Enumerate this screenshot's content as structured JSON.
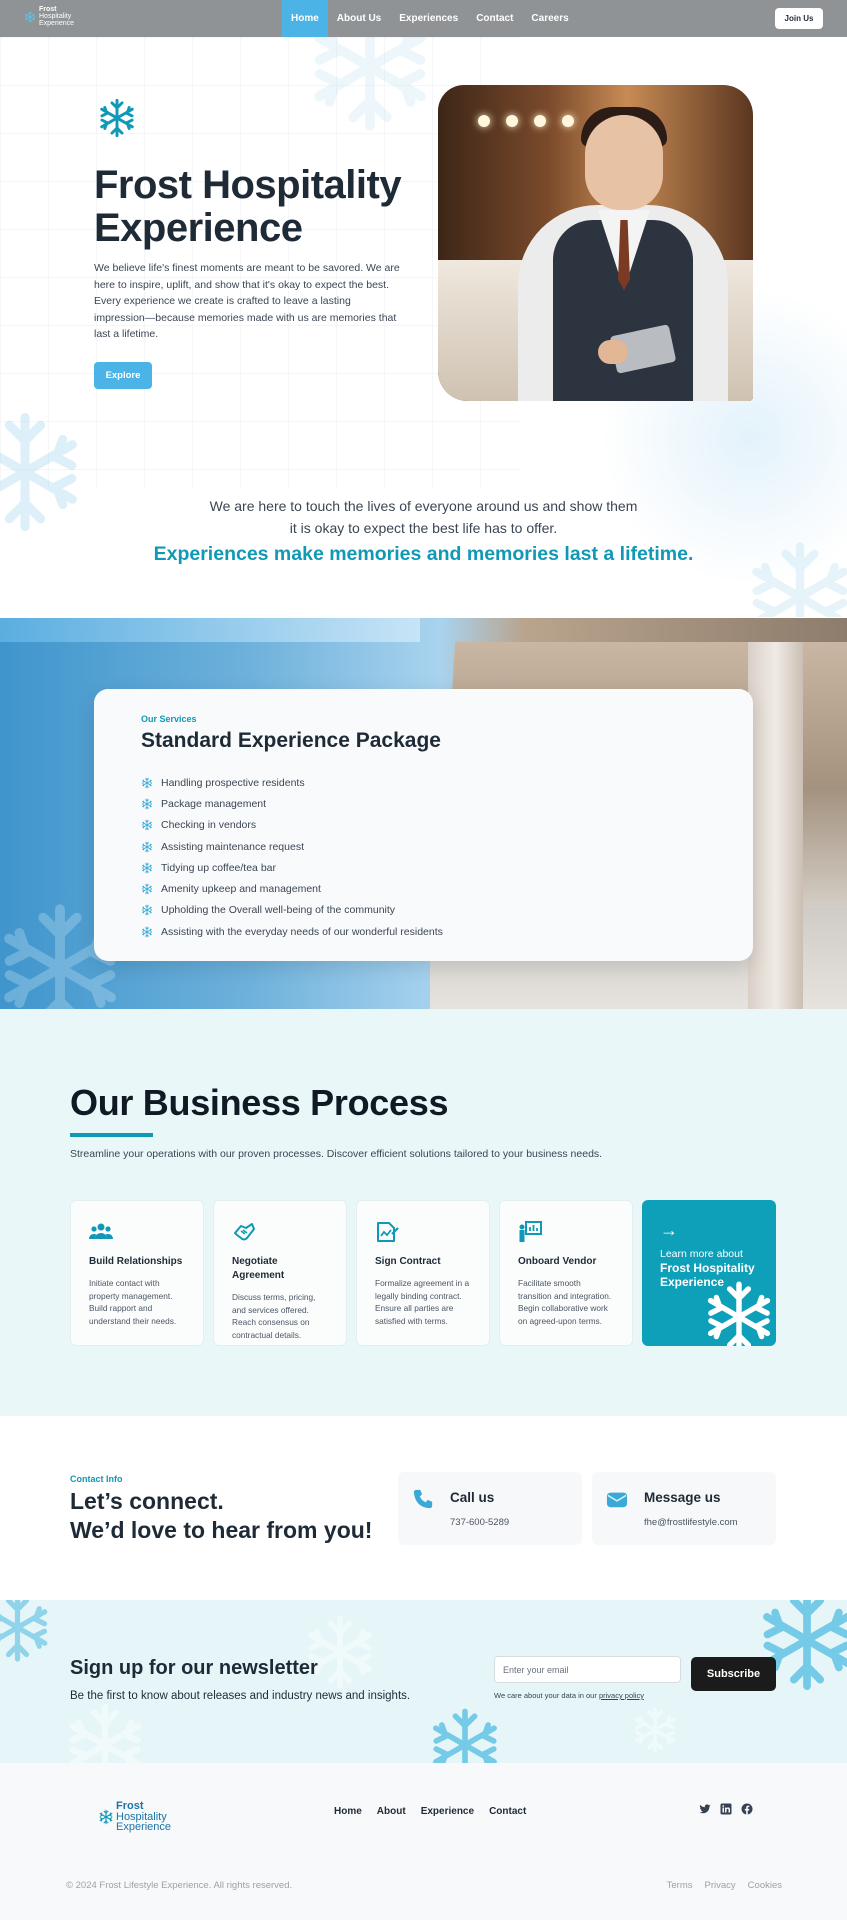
{
  "brand": {
    "logo_line1": "Frost",
    "logo_line2": "Hospitality",
    "logo_line3": "Experience",
    "accent_color": "#1099b6",
    "primary_button_color": "#4cb3e6"
  },
  "nav": {
    "items": [
      "Home",
      "About Us",
      "Experiences",
      "Contact",
      "Careers"
    ],
    "active": "Home",
    "join_label": "Join Us"
  },
  "hero": {
    "title": "Frost Hospitality Experience",
    "description": "We believe life's finest moments are meant to be savored. We are here to inspire, uplift, and show that it's okay to expect the best. Every experience we create is crafted to leave a lasting impression—because memories made with us are memories that last a lifetime.",
    "button_label": "Explore",
    "intro_line1": "We are here to touch the lives of everyone around us and show them",
    "intro_line2": "it is okay to expect the best life has to offer.",
    "tagline": "Experiences make memories and memories last a lifetime."
  },
  "services": {
    "eyebrow": "Our Services",
    "title": "Standard Experience Package",
    "items": [
      "Handling prospective residents",
      "Package management",
      "Checking in vendors",
      "Assisting maintenance request",
      "Tidying up coffee/tea bar",
      "Amenity upkeep and management",
      "Upholding the Overall well-being of the community",
      "Assisting with the everyday needs of our wonderful residents"
    ]
  },
  "process": {
    "title": "Our Business Process",
    "subtitle": "Streamline your operations with our proven processes. Discover efficient solutions tailored to your business needs.",
    "steps": [
      {
        "icon": "people-icon",
        "title": "Build Relationships",
        "desc": "Initiate contact with property management. Build rapport and understand their needs."
      },
      {
        "icon": "handshake-icon",
        "title": "Negotiate Agreement",
        "desc": "Discuss terms, pricing, and services offered. Reach consensus on contractual details."
      },
      {
        "icon": "contract-icon",
        "title": "Sign Contract",
        "desc": "Formalize agreement in a legally binding contract. Ensure all parties are satisfied with terms."
      },
      {
        "icon": "presenter-icon",
        "title": "Onboard Vendor",
        "desc": "Facilitate smooth transition and integration. Begin collaborative work on agreed-upon terms."
      }
    ],
    "cta": {
      "line1": "Learn more about",
      "line2": "Frost Hospitality Experience"
    }
  },
  "contact": {
    "eyebrow": "Contact Info",
    "title_line1": "Let’s connect.",
    "title_line2": "We’d love to hear from you!",
    "call": {
      "label": "Call us",
      "value": "737-600-5289"
    },
    "message": {
      "label": "Message us",
      "value": "fhe@frostlifestyle.com"
    }
  },
  "newsletter": {
    "title": "Sign up for our newsletter",
    "text": "Be the first to know about releases and industry news and insights.",
    "email_placeholder": "Enter your email",
    "button_label": "Subscribe",
    "note_prefix": "We care about your data in our ",
    "note_link": "privacy policy"
  },
  "footer": {
    "links": [
      "Home",
      "About",
      "Experience",
      "Contact"
    ],
    "social": [
      "twitter-icon",
      "linkedin-icon",
      "facebook-icon"
    ],
    "copyright": "© 2024 Frost Lifestyle Experience. All rights reserved.",
    "legal": [
      "Terms",
      "Privacy",
      "Cookies"
    ]
  }
}
